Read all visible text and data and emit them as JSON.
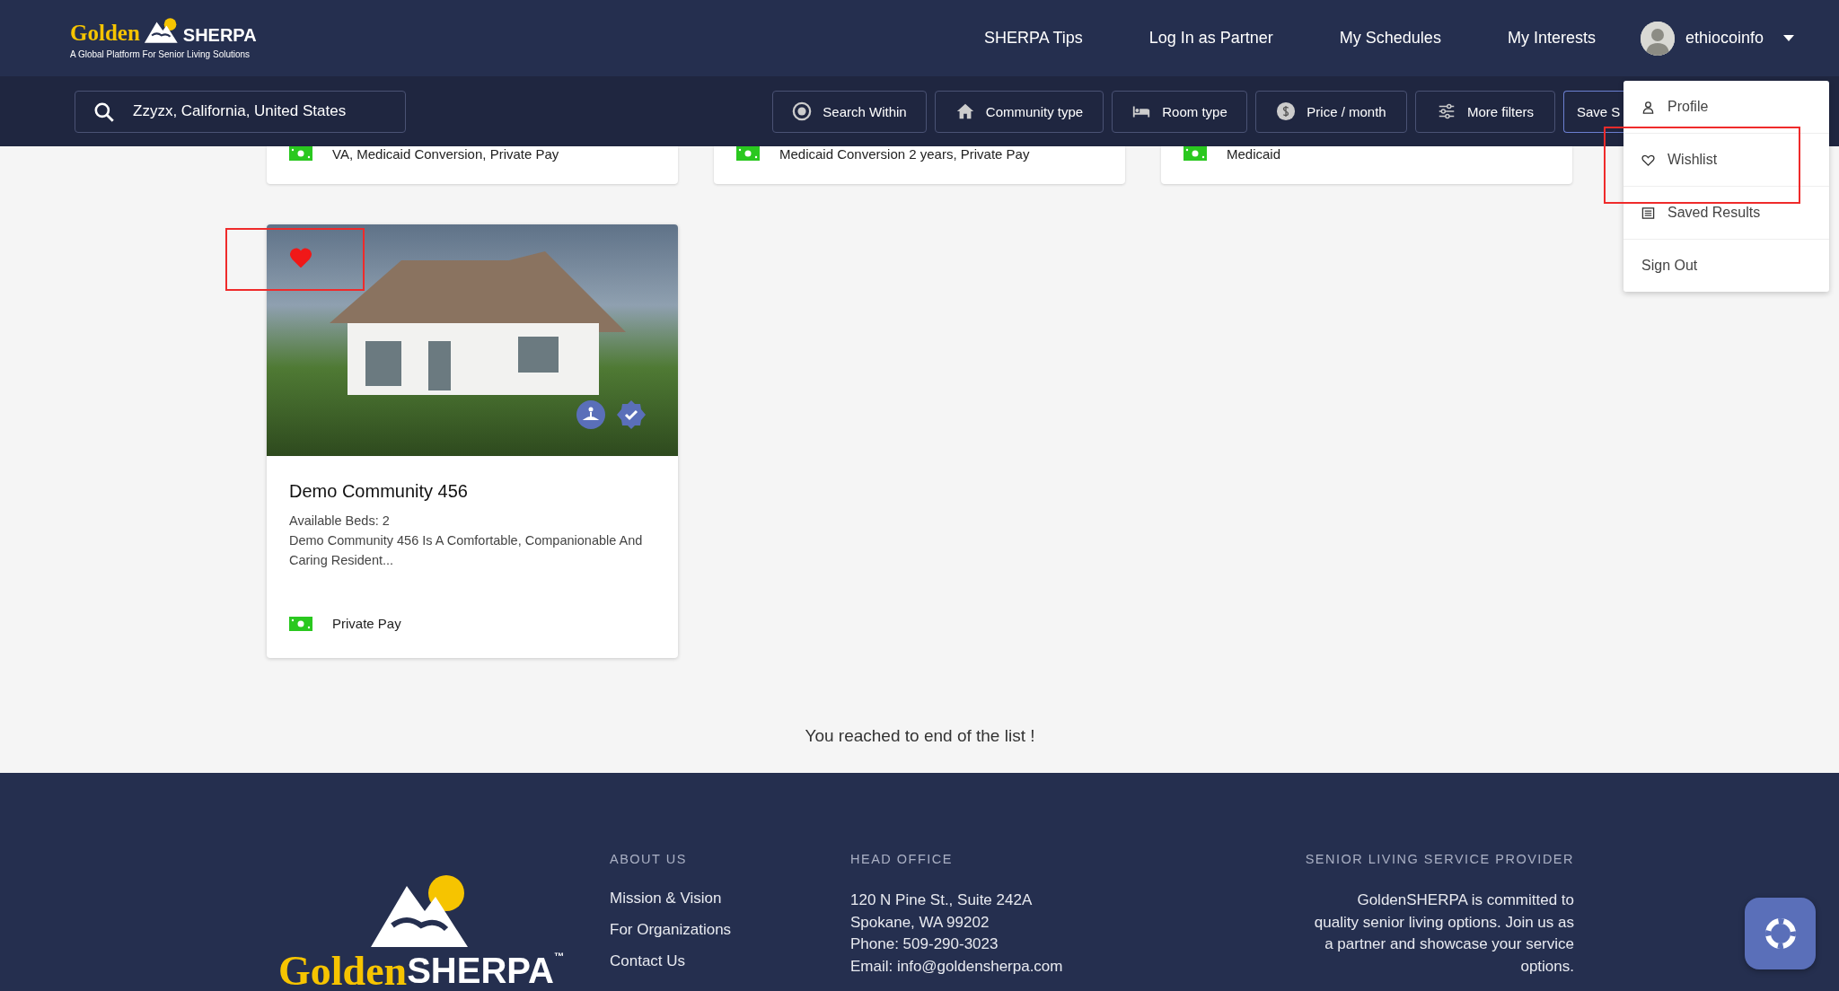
{
  "header": {
    "logo": {
      "word_left": "Golden",
      "word_right": "SHERPA",
      "tagline": "A Global Platform For Senior Living Solutions"
    },
    "nav": [
      "SHERPA Tips",
      "Log In as Partner",
      "My Schedules",
      "My Interests"
    ],
    "user": {
      "name": "ethiocoinfo"
    }
  },
  "search": {
    "value": "Zzyzx, California, United States"
  },
  "filters": [
    {
      "kind": "radius",
      "label": "Search Within"
    },
    {
      "kind": "home",
      "label": "Community type"
    },
    {
      "kind": "bed",
      "label": "Room type"
    },
    {
      "kind": "dollar",
      "label": "Price / month"
    },
    {
      "kind": "sliders",
      "label": "More filters"
    }
  ],
  "save_button": "Save S",
  "user_menu": [
    {
      "kind": "person",
      "label": "Profile"
    },
    {
      "kind": "heart",
      "label": "Wishlist"
    },
    {
      "kind": "list",
      "label": "Saved Results"
    },
    {
      "kind": "plain",
      "label": "Sign Out"
    }
  ],
  "previous_row": [
    {
      "payment": "VA, Medicaid Conversion, Private Pay"
    },
    {
      "payment": "Medicaid Conversion 2 years, Private Pay"
    },
    {
      "payment": "Medicaid"
    }
  ],
  "listing": {
    "favorited": true,
    "title": "Demo Community 456",
    "beds": "Available Beds: 2",
    "description": "Demo Community 456 Is A Comfortable, Companionable And Caring Resident...",
    "payment": "Private Pay"
  },
  "end_message": "You reached to end of the list !",
  "footer": {
    "logo": {
      "word_left": "Golden",
      "word_right": "SHERPA",
      "trademark": "™"
    },
    "about": {
      "heading": "ABOUT US",
      "links": [
        "Mission & Vision",
        "For Organizations",
        "Contact Us"
      ]
    },
    "office": {
      "heading": "HEAD OFFICE",
      "lines": [
        "120 N Pine St., Suite 242A",
        "Spokane, WA 99202",
        "Phone: 509-290-3023",
        "Email: info@goldensherpa.com"
      ]
    },
    "provider": {
      "heading": "SENIOR LIVING SERVICE PROVIDER",
      "text": "GoldenSHERPA is committed to quality senior living options. Join us as a partner and showcase your service options."
    }
  }
}
